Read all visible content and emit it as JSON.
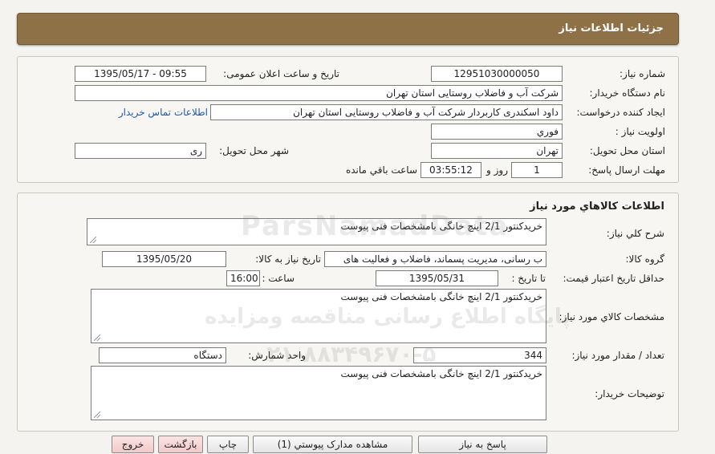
{
  "header": {
    "title": "جزئیات اطلاعات نیاز"
  },
  "need_info": {
    "need_number_label": "شماره نیاز:",
    "need_number": "12951030000050",
    "announce_label": "تاریخ و ساعت اعلان عمومی:",
    "announce_value": "1395/05/17 - 09:55",
    "buyer_org_label": "نام دستگاه خریدار:",
    "buyer_org": "شرکت آب و فاضلاب روستایی استان تهران",
    "creator_label": "ایجاد کننده درخواست:",
    "creator": "داود اسکندری  کاربردار شرکت آب و فاضلاب روستایی استان تهران",
    "contact_link": "اطلاعات تماس خریدار",
    "priority_label": "اولویت نیاز :",
    "priority": "فوري",
    "province_label": "استان محل تحویل:",
    "province": "تهران",
    "city_label": "شهر محل تحویل:",
    "city": "ری",
    "deadline_label": "مهلت ارسال پاسخ:",
    "deadline_days": "1",
    "days_word": "روز و",
    "deadline_time": "03:55:12",
    "remaining_word": "ساعت باقي مانده"
  },
  "goods": {
    "section_title": "اطلاعات کالاهاي مورد نياز",
    "general_desc_label": "شرح کلي نياز:",
    "general_desc": "خریدکنتور 2/1 اینچ خانگی بامشخصات فنی پیوست",
    "group_label": "گروه کالا:",
    "group_value": "ب رسانی، مدیریت پسماند، فاضلاب و فعالیت های",
    "need_date_label": "تاريخ نياز به کالا:",
    "need_date": "1395/05/20",
    "validity_label": "حداقل تاريخ اعتبار قيمت:",
    "until_date_label": "تا تاريخ :",
    "until_date": "1395/05/31",
    "time_label": "ساعت :",
    "time_value": "16:00",
    "specs_label": "مشخصات کالاي مورد نياز:",
    "specs": "خریدکنتور 2/1 اینچ خانگی بامشخصات فنی پیوست",
    "quantity_label": "تعداد / مقدار مورد نياز:",
    "quantity": "344",
    "unit_label": "واحد شمارش:",
    "unit": "دستگاه",
    "buyer_notes_label": "توضيحات خريدار:",
    "buyer_notes": "خریدکنتور 2/1 اینچ خانگی بامشخصات فنی پیوست"
  },
  "buttons": {
    "reply": "پاسخ به نياز",
    "attachments": "مشاهده مدارک پيوستي (1)",
    "print": "چاپ",
    "back": "بازگشت",
    "exit": "خروج"
  },
  "watermark": {
    "line1": "ParsNamadData",
    "line2": "پایگاه اطلاع رسانی مناقصه ومزایده",
    "line3": "۰۲۱-۸۸۳۴۹۶۷۰-۵"
  }
}
